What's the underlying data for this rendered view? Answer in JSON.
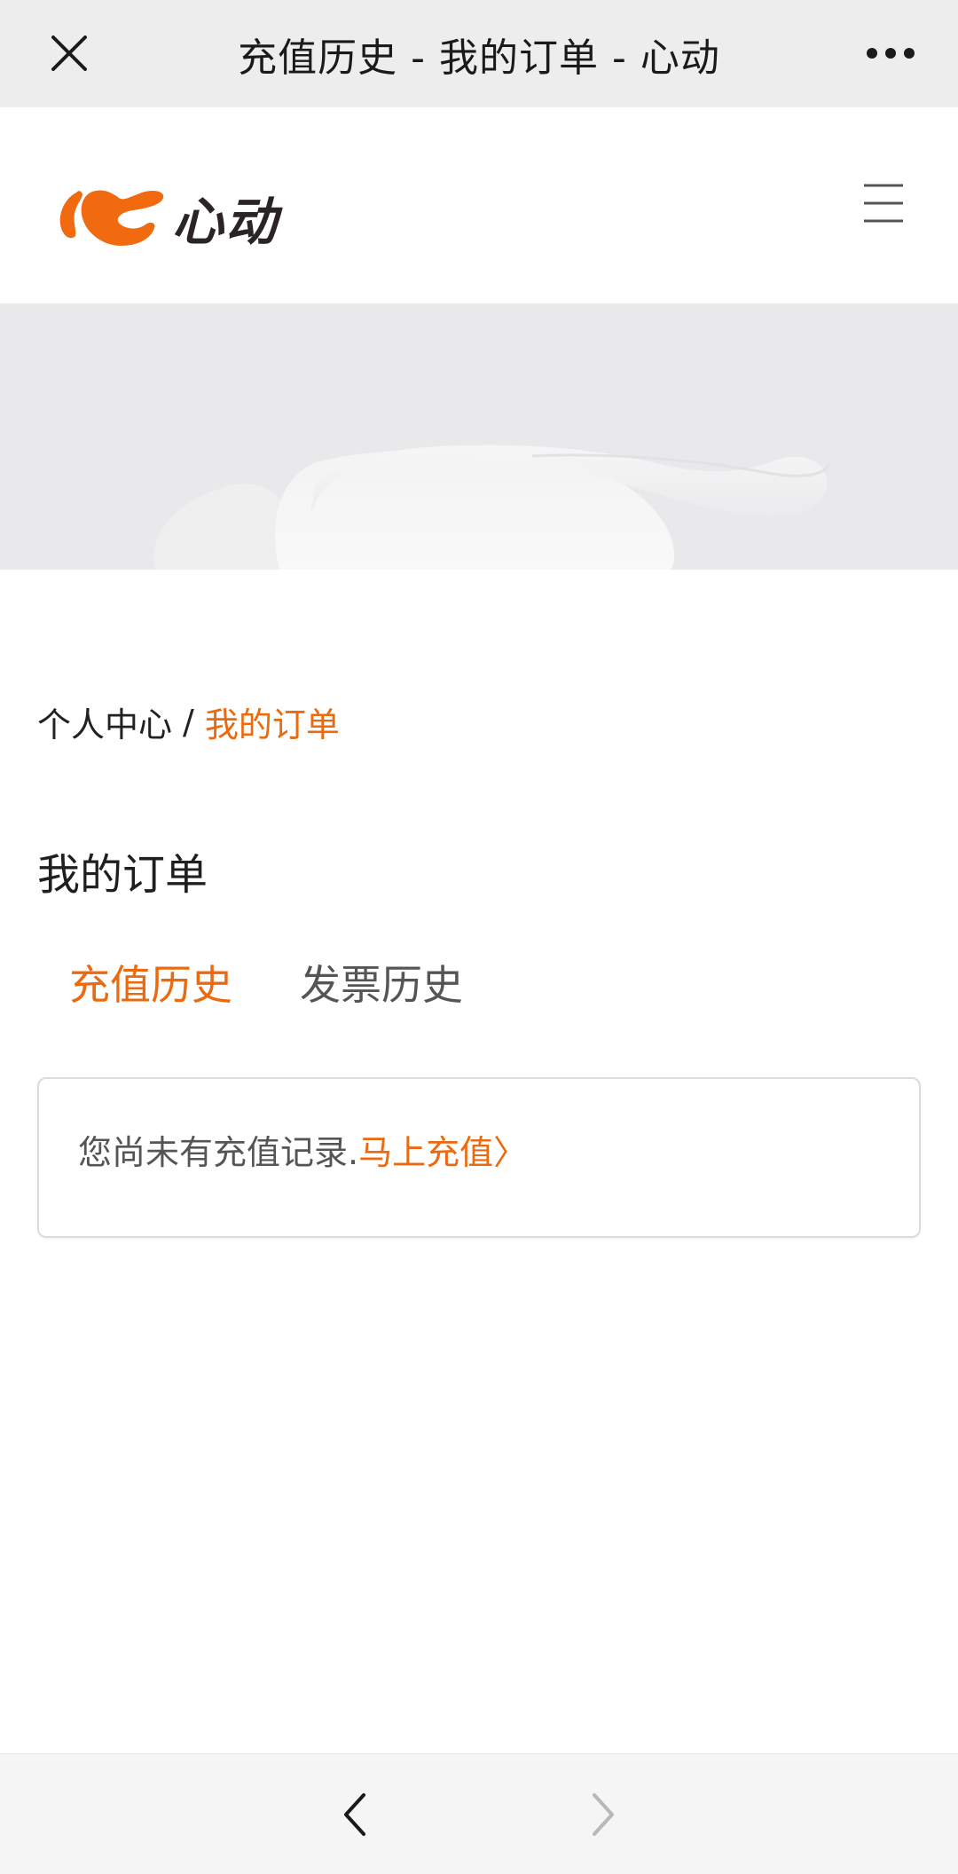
{
  "topbar": {
    "title": "充值历史 - 我的订单 - 心动"
  },
  "header": {
    "logo_text": "心动"
  },
  "breadcrumb": {
    "parent": "个人中心",
    "separator": "/",
    "current": "我的订单"
  },
  "page": {
    "title": "我的订单"
  },
  "tabs": [
    {
      "label": "充值历史",
      "active": true
    },
    {
      "label": "发票历史",
      "active": false
    }
  ],
  "empty_state": {
    "message": "您尚未有充值记录.",
    "link_label": "马上充值〉"
  },
  "colors": {
    "accent": "#ec6a0f",
    "topbar_bg": "#ededed",
    "banner_bg": "#e9e9eb",
    "text_dark": "#222222"
  },
  "icons": {
    "close": "close-icon",
    "more": "more-icon",
    "menu": "hamburger-menu-icon",
    "back": "chevron-left-icon",
    "forward": "chevron-right-icon"
  }
}
